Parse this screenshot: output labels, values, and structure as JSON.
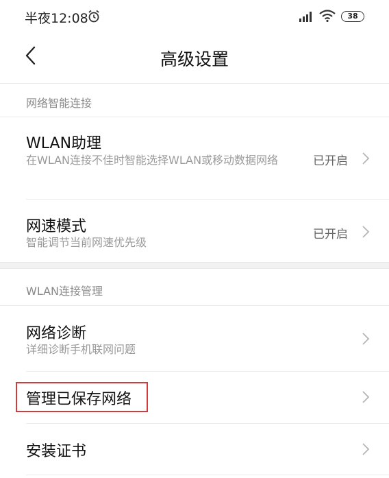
{
  "status_bar": {
    "time": "半夜12:08",
    "battery": "38",
    "icons": [
      "alarm-icon",
      "signal-icon",
      "wifi-icon",
      "battery-icon"
    ]
  },
  "header": {
    "title": "高级设置",
    "back_icon": "chevron-left-icon"
  },
  "sections": [
    {
      "header": "网络智能连接",
      "items": [
        {
          "title": "WLAN助理",
          "subtitle": "在WLAN连接不佳时智能选择WLAN或移动数据网络",
          "status": "已开启"
        },
        {
          "title": "网速模式",
          "subtitle": "智能调节当前网速优先级",
          "status": "已开启"
        }
      ]
    },
    {
      "header": "WLAN连接管理",
      "items": [
        {
          "title": "网络诊断",
          "subtitle": "详细诊断手机联网问题"
        },
        {
          "title": "管理已保存网络",
          "highlighted": true
        },
        {
          "title": "安装证书"
        }
      ]
    }
  ],
  "colors": {
    "highlight": "#d43a3a",
    "secondary_text": "#9a9a9a"
  }
}
